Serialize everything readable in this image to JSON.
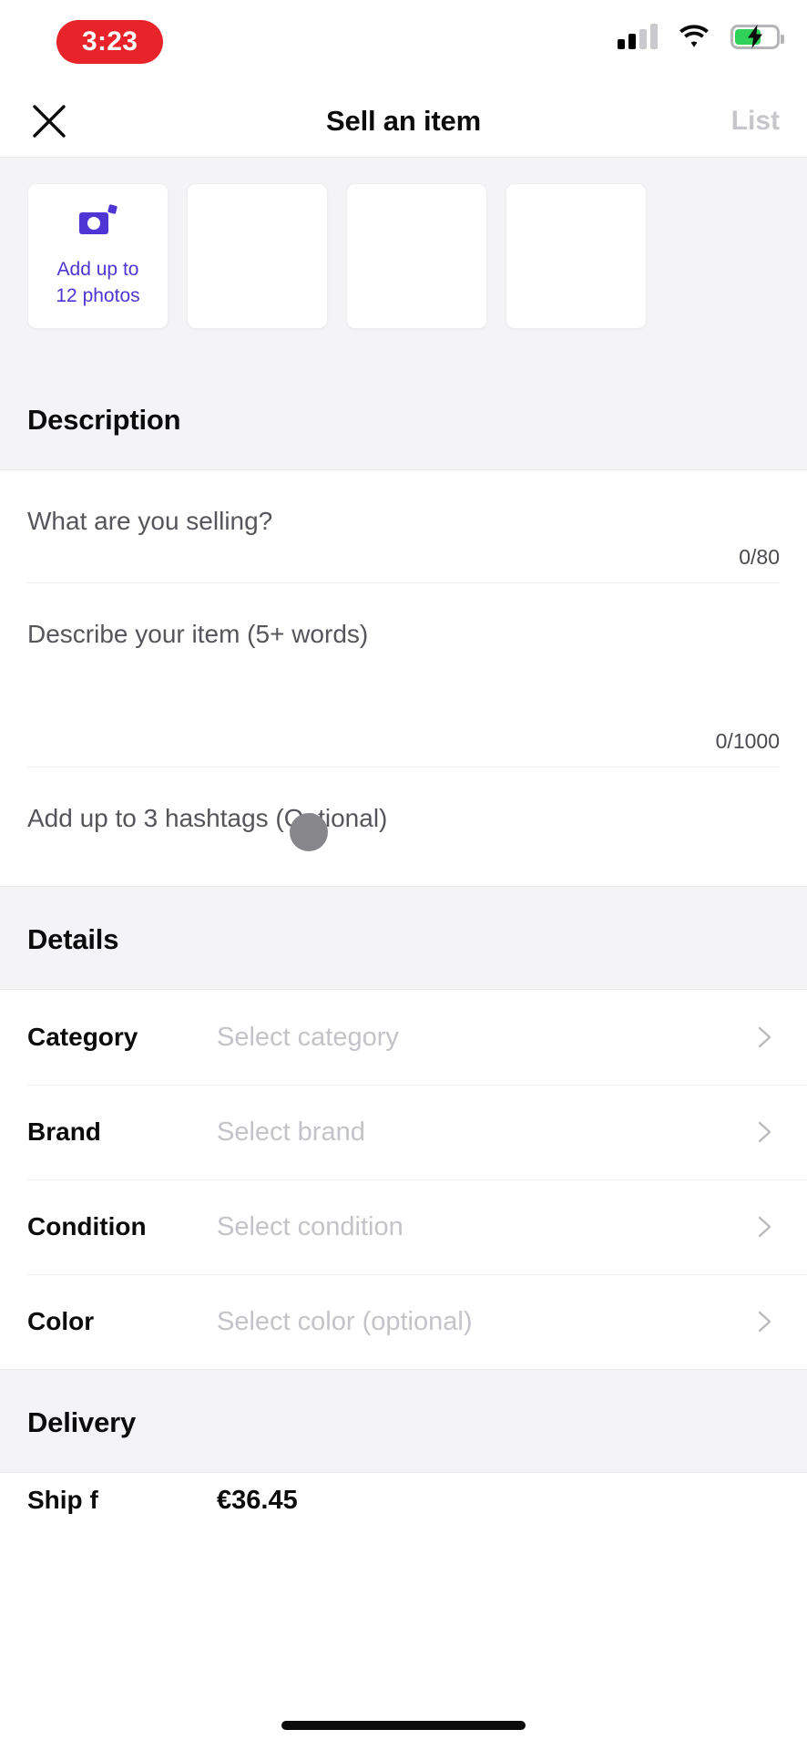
{
  "status_bar": {
    "recording_time": "3:23",
    "recording_pill_color": "#e8232a",
    "signal_icon": "cellular-signal-icon",
    "wifi_icon": "wifi-icon",
    "battery_icon": "battery-charging-icon",
    "battery_fill_color": "#30d158"
  },
  "nav": {
    "close_icon": "close-icon",
    "title": "Sell an item",
    "list_label": "List",
    "list_color": "#c6c6cb"
  },
  "photos": {
    "add_icon": "camera-icon",
    "add_label_line1": "Add up to",
    "add_label_line2": "12 photos",
    "accent_color": "#4e35d4",
    "slots": [
      {
        "name": "photo-slot-1",
        "filled": false
      },
      {
        "name": "photo-slot-2",
        "filled": false
      },
      {
        "name": "photo-slot-3",
        "filled": false
      },
      {
        "name": "photo-slot-4",
        "filled": false
      }
    ]
  },
  "description": {
    "heading": "Description",
    "title_field": {
      "placeholder": "What are you selling?",
      "counter": "0/80"
    },
    "body_field": {
      "placeholder": "Describe your item (5+ words)",
      "counter": "0/1000"
    },
    "hashtags_field": {
      "placeholder": "Add up to 3 hashtags (Optional)"
    }
  },
  "details": {
    "heading": "Details",
    "rows": [
      {
        "label": "Category",
        "value": "Select category",
        "chevron": "chevron-right-icon"
      },
      {
        "label": "Brand",
        "value": "Select brand",
        "chevron": "chevron-right-icon"
      },
      {
        "label": "Condition",
        "value": "Select condition",
        "chevron": "chevron-right-icon"
      },
      {
        "label": "Color",
        "value": "Select color (optional)",
        "chevron": "chevron-right-icon"
      }
    ]
  },
  "delivery": {
    "heading": "Delivery",
    "partial_row": {
      "label": "Ship f",
      "value": "€36.45"
    }
  },
  "touch_indicator": {
    "name": "touch-indicator",
    "color": "#86868b"
  }
}
